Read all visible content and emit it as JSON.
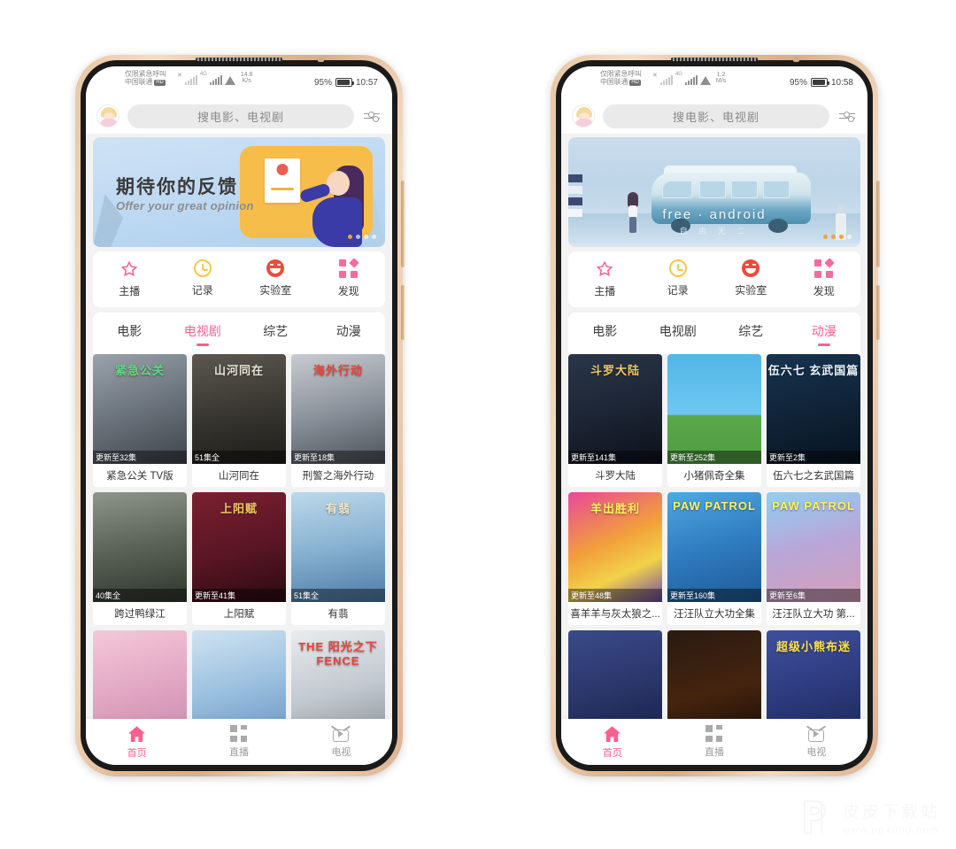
{
  "watermark": {
    "site": "皮皮下载站",
    "url": "www.pp4000.com"
  },
  "phones": [
    {
      "id": "left",
      "status": {
        "carrier_line1": "仅限紧急呼叫",
        "carrier_line2": "中国联通",
        "hd_badge": "HD",
        "net_rate": "14.8",
        "net_unit": "K/s",
        "battery_pct": "95%",
        "time": "10:57",
        "gen_label": "4G"
      },
      "search": {
        "placeholder": "搜电影、电视剧"
      },
      "banner": {
        "title": "期待你的反馈",
        "subtitle": "Offer your great opinion",
        "variant": "feedback"
      },
      "quick": [
        {
          "label": "主播",
          "icon": "star-icon"
        },
        {
          "label": "记录",
          "icon": "clock-icon"
        },
        {
          "label": "实验室",
          "icon": "smiley-icon"
        },
        {
          "label": "发现",
          "icon": "grid-icon"
        }
      ],
      "tabs": [
        {
          "label": "电影",
          "active": false
        },
        {
          "label": "电视剧",
          "active": true
        },
        {
          "label": "综艺",
          "active": false
        },
        {
          "label": "动漫",
          "active": false
        }
      ],
      "cards": [
        {
          "title": "紧急公关 TV版",
          "episodes": "更新至32集",
          "poster_title": "紧急公关",
          "art": "pr"
        },
        {
          "title": "山河同在",
          "episodes": "51集全",
          "poster_title": "山河同在",
          "art": "war1"
        },
        {
          "title": "刑警之海外行动",
          "episodes": "更新至18集",
          "poster_title": "海外行动",
          "art": "police"
        },
        {
          "title": "跨过鸭绿江",
          "episodes": "40集全",
          "poster_title": "",
          "art": "battle"
        },
        {
          "title": "上阳赋",
          "episodes": "更新至41集",
          "poster_title": "上阳赋",
          "art": "empress"
        },
        {
          "title": "有翡",
          "episodes": "51集全",
          "poster_title": "有翡",
          "art": "wuxia"
        },
        {
          "title": "",
          "episodes": "",
          "poster_title": "",
          "art": "pink"
        },
        {
          "title": "",
          "episodes": "",
          "poster_title": "",
          "art": "blue"
        },
        {
          "title": "",
          "episodes": "",
          "poster_title": "THE 阳光之下 FENCE",
          "art": "sunlight"
        }
      ],
      "bottom_nav": [
        {
          "label": "首页",
          "icon": "home-icon",
          "active": true
        },
        {
          "label": "直播",
          "icon": "live-grid-icon",
          "active": false
        },
        {
          "label": "电视",
          "icon": "tv-icon",
          "active": false
        }
      ]
    },
    {
      "id": "right",
      "status": {
        "carrier_line1": "仅限紧急呼叫",
        "carrier_line2": "中国联通",
        "hd_badge": "HD",
        "net_rate": "1.2",
        "net_unit": "M/s",
        "battery_pct": "95%",
        "time": "10:58",
        "gen_label": "4G"
      },
      "search": {
        "placeholder": "搜电影、电视剧"
      },
      "banner": {
        "title": "free · android",
        "subtitle": "自 由 无 二",
        "variant": "van"
      },
      "quick": [
        {
          "label": "主播",
          "icon": "star-icon"
        },
        {
          "label": "记录",
          "icon": "clock-icon"
        },
        {
          "label": "实验室",
          "icon": "smiley-icon"
        },
        {
          "label": "发现",
          "icon": "grid-icon"
        }
      ],
      "tabs": [
        {
          "label": "电影",
          "active": false
        },
        {
          "label": "电视剧",
          "active": false
        },
        {
          "label": "综艺",
          "active": false
        },
        {
          "label": "动漫",
          "active": true
        }
      ],
      "cards": [
        {
          "title": "斗罗大陆",
          "episodes": "更新至141集",
          "poster_title": "斗罗大陆",
          "art": "douluo"
        },
        {
          "title": "小猪佩奇全集",
          "episodes": "更新至252集",
          "poster_title": "",
          "art": "peppa"
        },
        {
          "title": "伍六七之玄武国篇",
          "episodes": "更新至2集",
          "poster_title": "伍六七 玄武国篇",
          "art": "seven"
        },
        {
          "title": "喜羊羊与灰太狼之...",
          "episodes": "更新至48集",
          "poster_title": "羊出胜利",
          "art": "goat"
        },
        {
          "title": "汪汪队立大功全集",
          "episodes": "更新至160集",
          "poster_title": "PAW PATROL",
          "art": "paw1"
        },
        {
          "title": "汪汪队立大功 第...",
          "episodes": "更新至6集",
          "poster_title": "PAW PATROL",
          "art": "paw2"
        },
        {
          "title": "",
          "episodes": "",
          "poster_title": "",
          "art": "night"
        },
        {
          "title": "",
          "episodes": "",
          "poster_title": "",
          "art": "dark"
        },
        {
          "title": "",
          "episodes": "",
          "poster_title": "超级小熊布迷",
          "art": "bear"
        }
      ],
      "bottom_nav": [
        {
          "label": "首页",
          "icon": "home-icon",
          "active": true
        },
        {
          "label": "直播",
          "icon": "live-grid-icon",
          "active": false
        },
        {
          "label": "电视",
          "icon": "tv-icon",
          "active": false
        }
      ]
    }
  ],
  "colors": {
    "accent": "#fb5f8e",
    "star": "#fb5f8e",
    "clock": "#f5c84a",
    "smiley": "#ee4a3a",
    "grid": "#f66b9d"
  }
}
